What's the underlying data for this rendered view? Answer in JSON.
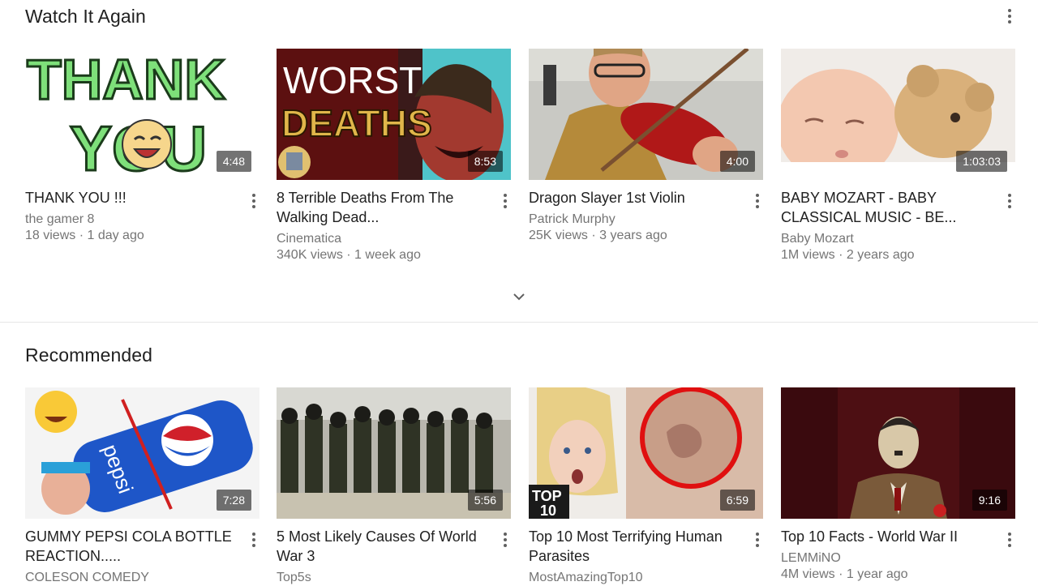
{
  "watch_again": {
    "title": "Watch It Again",
    "videos": [
      {
        "title": "THANK YOU !!!",
        "channel": "the gamer 8",
        "stats": "18 views · 1 day ago",
        "duration": "4:48",
        "thumb_text_1": "THANK",
        "thumb_text_2": "YOU"
      },
      {
        "title": "8 Terrible Deaths From The Walking Dead...",
        "channel": "Cinematica",
        "stats": "340K views · 1 week ago",
        "duration": "8:53",
        "thumb_text_1": "WORST",
        "thumb_text_2": "DEATHS"
      },
      {
        "title": "Dragon Slayer 1st Violin",
        "channel": "Patrick Murphy",
        "stats": "25K views · 3 years ago",
        "duration": "4:00"
      },
      {
        "title": "BABY MOZART - BABY CLASSICAL MUSIC - BE...",
        "channel": "Baby Mozart",
        "stats": "1M views · 2 years ago",
        "duration": "1:03:03"
      }
    ]
  },
  "recommended": {
    "title": "Recommended",
    "videos": [
      {
        "title": "GUMMY PEPSI COLA BOTTLE REACTION.....",
        "channel": "COLESON COMEDY",
        "stats": "",
        "duration": "7:28",
        "thumb_text_1": "pepsi"
      },
      {
        "title": "5 Most Likely Causes Of World War 3",
        "channel": "Top5s",
        "stats": "",
        "duration": "5:56"
      },
      {
        "title": "Top 10 Most Terrifying Human Parasites",
        "channel": "MostAmazingTop10",
        "stats": "",
        "duration": "6:59",
        "thumb_text_1": "TOP",
        "thumb_text_2": "10"
      },
      {
        "title": "Top 10 Facts - World War II",
        "channel": "LEMMiNO",
        "stats": "4M views · 1 year ago",
        "duration": "9:16"
      }
    ]
  },
  "icons": {
    "more": "more-vert-icon",
    "expand": "chevron-down-icon"
  },
  "colors": {
    "text_primary": "#212121",
    "text_secondary": "#757575",
    "duration_bg": "#000000"
  }
}
